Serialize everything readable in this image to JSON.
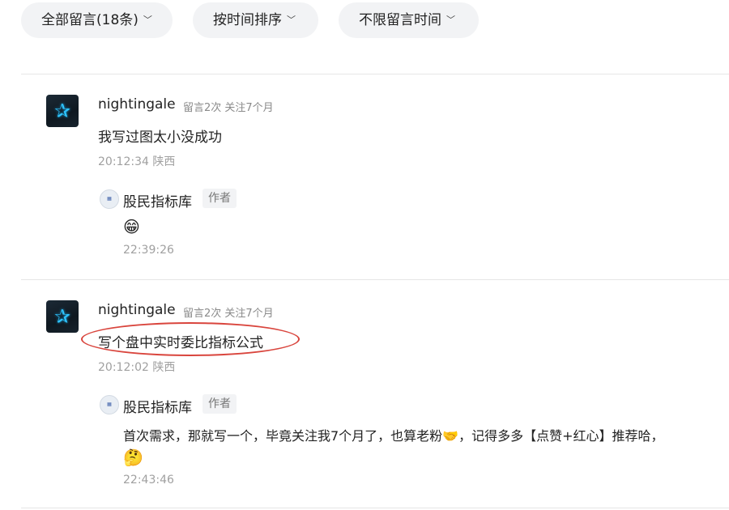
{
  "filters": {
    "all_comments": "全部留言(18条)",
    "sort_by_time": "按时间排序",
    "time_range": "不限留言时间",
    "chevron": "﹀"
  },
  "comments": [
    {
      "username": "nightingale",
      "meta": "留言2次 关注7个月",
      "text": "我写过图太小没成功",
      "time": "20:12:34 陕西",
      "reply": {
        "name": "股民指标库",
        "tag": "作者",
        "text": "",
        "emoji": "😁",
        "time": "22:39:26"
      }
    },
    {
      "username": "nightingale",
      "meta": "留言2次 关注7个月",
      "text": "写个盘中实时委比指标公式",
      "time": "20:12:02 陕西",
      "reply": {
        "name": "股民指标库",
        "tag": "作者",
        "text": "首次需求，那就写一个，毕竟关注我7个月了，也算老粉🤝，记得多多【点赞+红心】推荐哈，",
        "emoji": "🤔",
        "time": "22:43:46"
      }
    }
  ],
  "colors": {
    "pill_bg": "#f2f3f5",
    "highlight": "#d9453d",
    "avatar_star": "#2ec4ff"
  }
}
